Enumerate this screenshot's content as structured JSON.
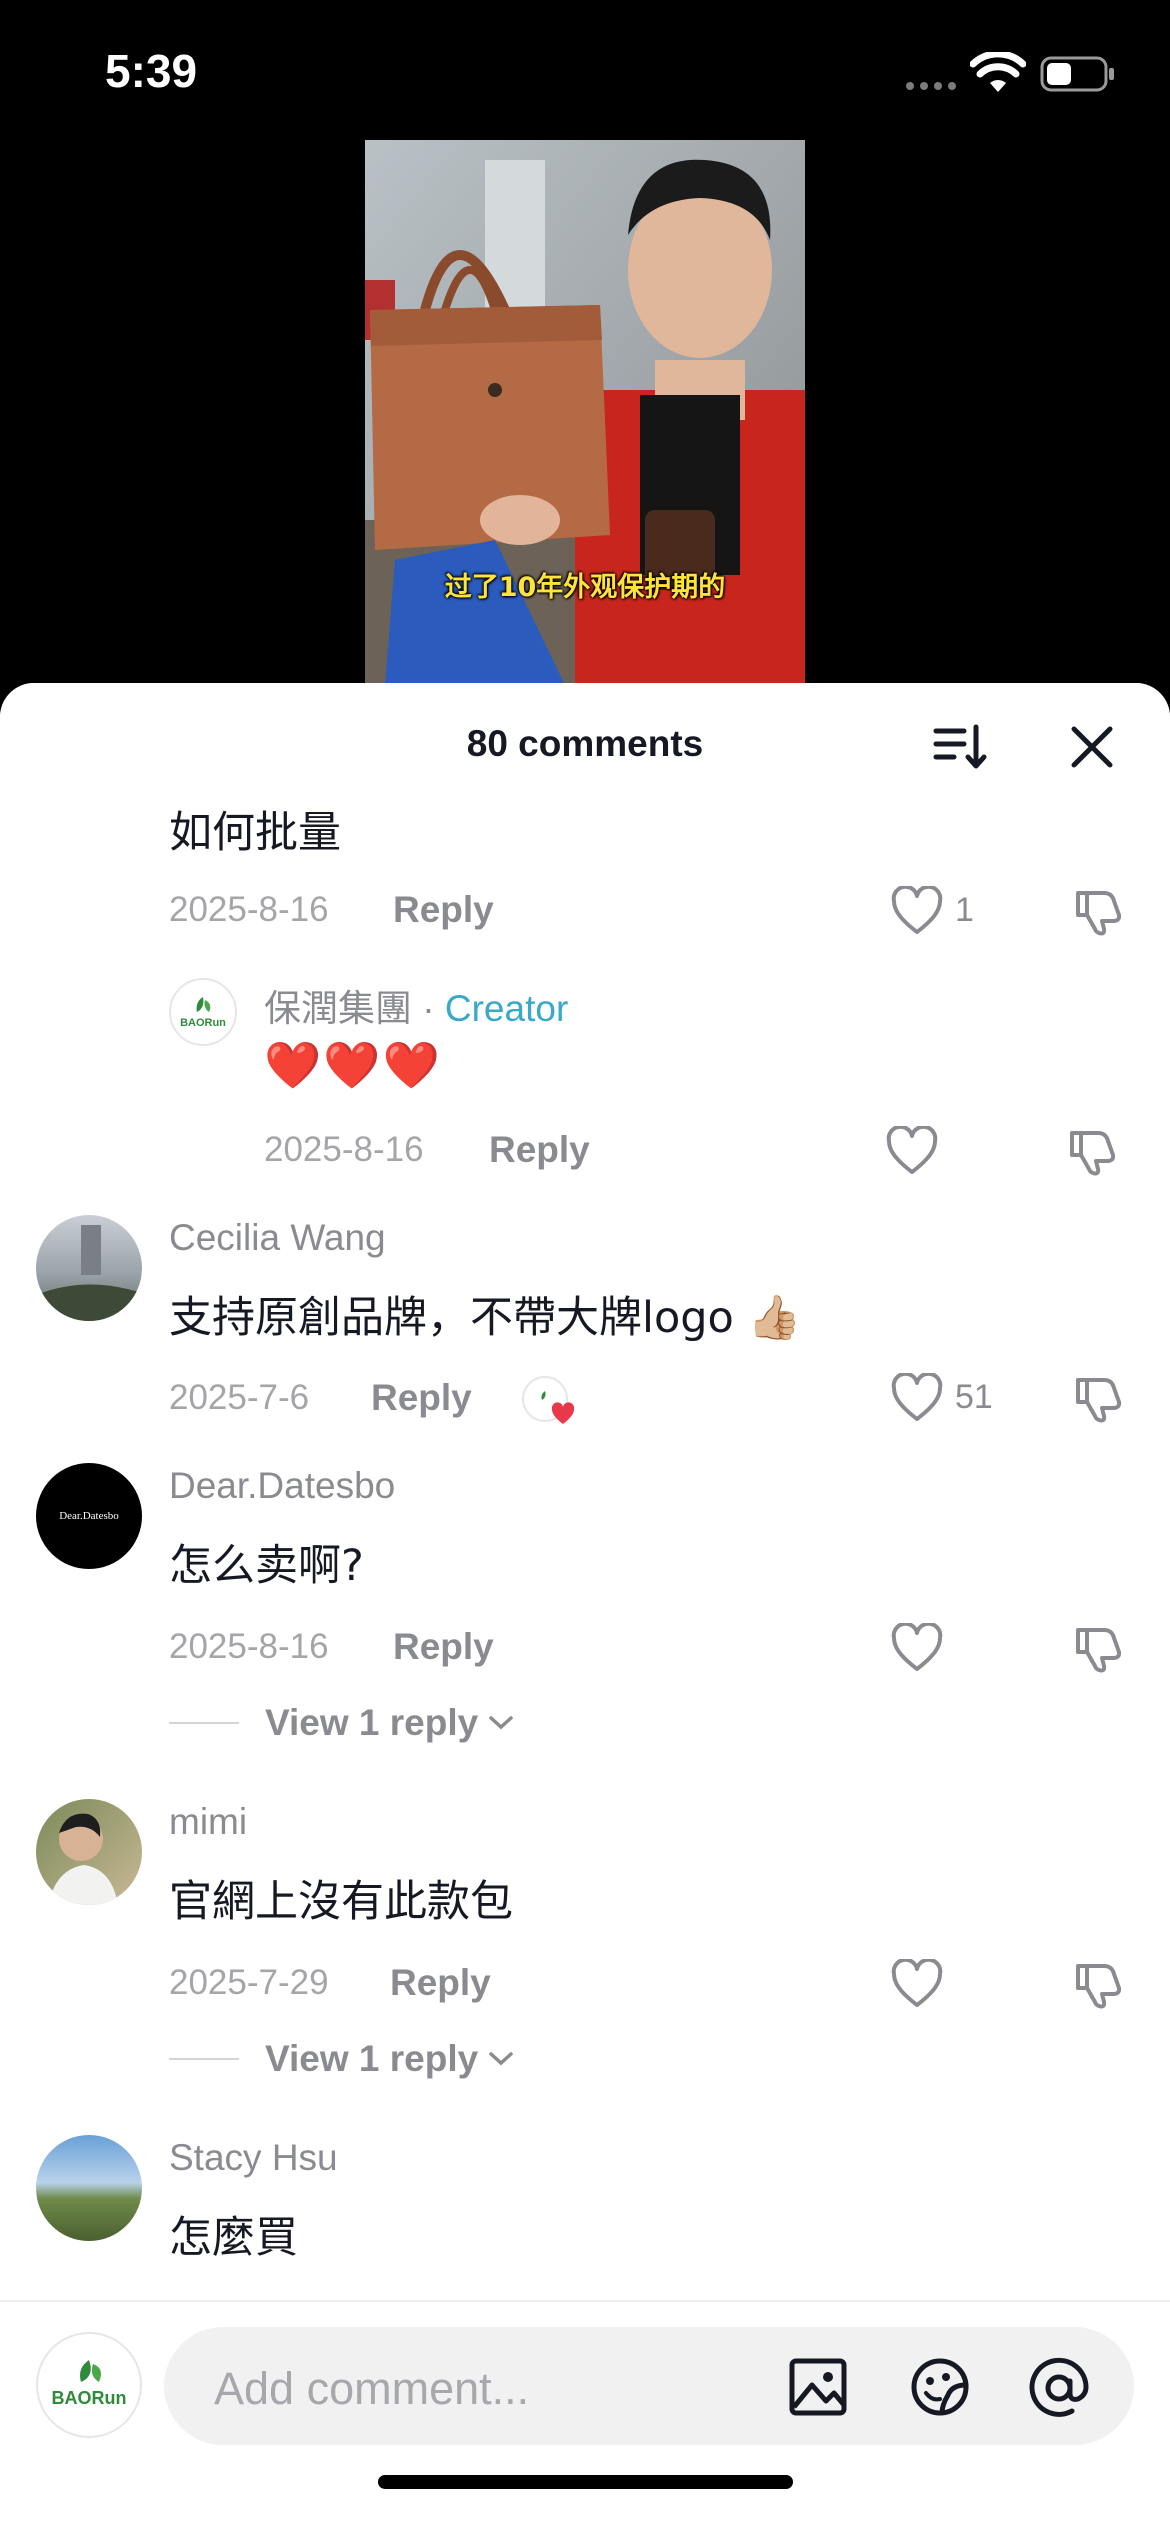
{
  "status_bar": {
    "time": "5:39"
  },
  "video": {
    "caption": "过了10年外观保护期的"
  },
  "sheet": {
    "title": "80 comments"
  },
  "comments": [
    {
      "text": "如何批量",
      "date": "2025-8-16",
      "reply_label": "Reply",
      "likes": "1",
      "replies": [
        {
          "user": "保潤集團",
          "creator_sep": " · ",
          "creator_label": "Creator",
          "text": "❤️❤️❤️",
          "date": "2025-8-16",
          "reply_label": "Reply"
        }
      ]
    },
    {
      "user": "Cecilia Wang",
      "text": "支持原創品牌，不帶大牌logo 👍🏼",
      "date": "2025-7-6",
      "reply_label": "Reply",
      "likes": "51"
    },
    {
      "user": "Dear.Datesbo",
      "avatar_text": "Dear.Datesbo",
      "text": "怎么卖啊?",
      "date": "2025-8-16",
      "reply_label": "Reply",
      "view_replies": "View 1 reply"
    },
    {
      "user": "mimi",
      "text": "官網上沒有此款包",
      "date": "2025-7-29",
      "reply_label": "Reply",
      "view_replies": "View 1 reply"
    },
    {
      "user": "Stacy Hsu",
      "text": "怎麼買"
    }
  ],
  "composer": {
    "placeholder": "Add comment..."
  },
  "brand": {
    "logo_text": "BAORun"
  },
  "colors": {
    "creator": "#3aa8c8",
    "heart": "#e8394a",
    "muted": "#8a8b91"
  }
}
